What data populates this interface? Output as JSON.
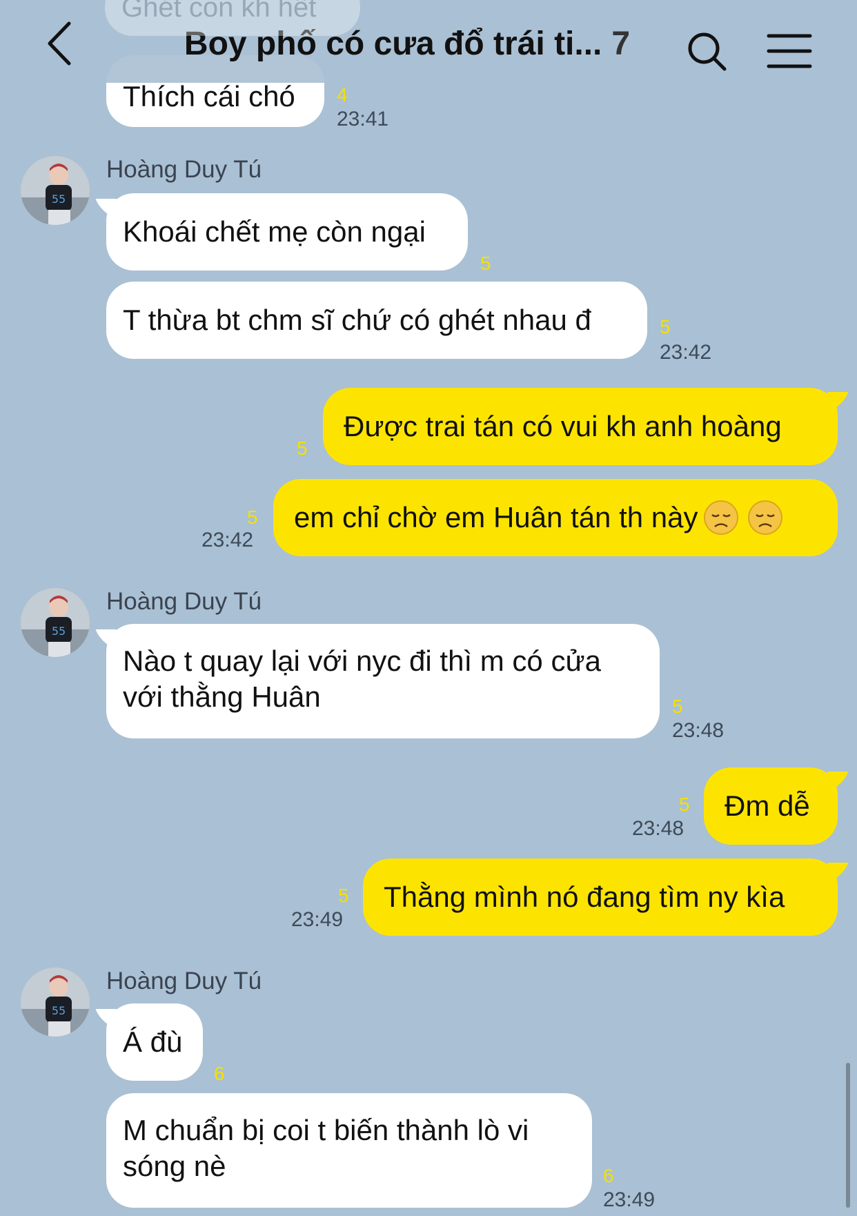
{
  "header": {
    "title": "Boy phố có cưa đổ trái ti...",
    "member_count": "7"
  },
  "faded_message": "Ghét con kh hết",
  "messages": [
    {
      "text": "Thích cái chó",
      "read": "4",
      "time": "23:41"
    },
    {
      "sender": "Hoàng Duy Tú",
      "text": "Khoái chết mẹ còn ngại",
      "read": "5"
    },
    {
      "text": "T thừa bt chm sĩ chứ có ghét nhau đ",
      "read": "5",
      "time": "23:42"
    },
    {
      "text": "Được trai tán có vui kh anh hoàng",
      "read": "5"
    },
    {
      "text": "em chỉ chờ em Huân tán th này",
      "read": "5",
      "time": "23:42"
    },
    {
      "sender": "Hoàng Duy Tú",
      "text_line1": "Nào t quay lại với nyc đi thì m có cửa",
      "text_line2": "với thằng Huân",
      "read": "5",
      "time": "23:48"
    },
    {
      "text": "Đm dễ",
      "read": "5",
      "time": "23:48"
    },
    {
      "text": "Thằng mình nó đang tìm ny kìa",
      "read": "5",
      "time": "23:49"
    },
    {
      "sender": "Hoàng Duy Tú",
      "text": "Á đù",
      "read": "6"
    },
    {
      "text_line1": "M chuẩn bị coi t biến thành lò vi",
      "text_line2": "sóng nè",
      "read": "6",
      "time": "23:49"
    }
  ],
  "colors": {
    "background": "#aac0d4",
    "incoming": "#ffffff",
    "outgoing": "#fde400",
    "read_count": "#f5e000"
  },
  "icons": [
    "back-chevron-icon",
    "search-icon",
    "menu-icon",
    "sad-face-emoji"
  ]
}
